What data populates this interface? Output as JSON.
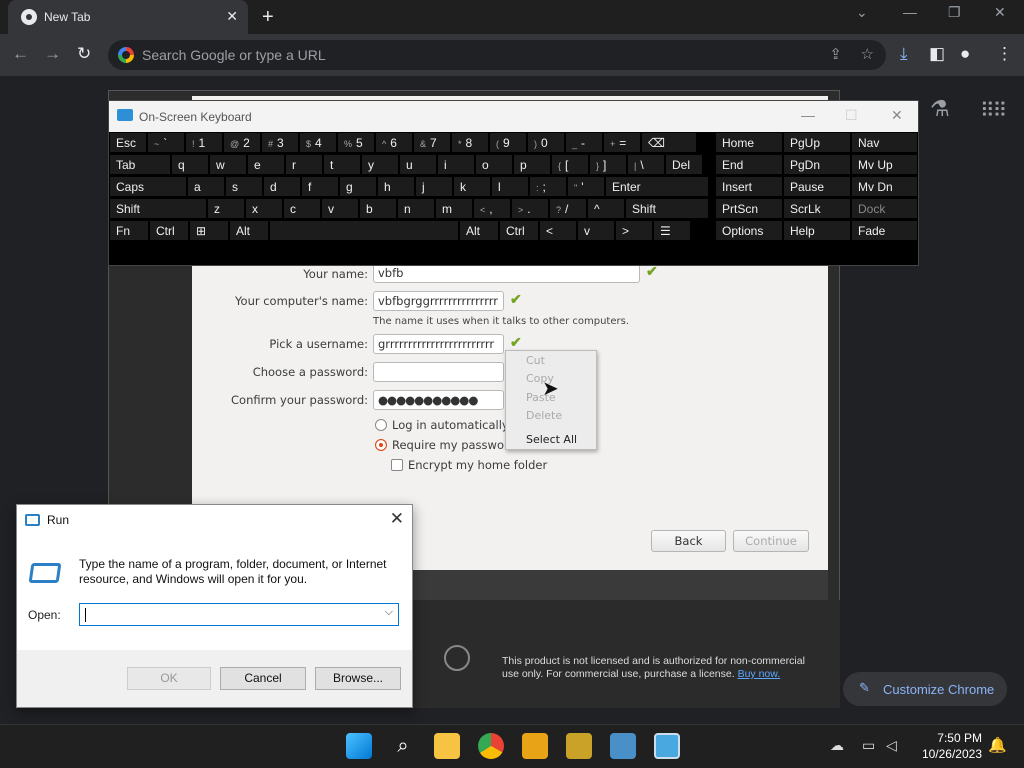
{
  "browser": {
    "tab_title": "New Tab",
    "omnibox_placeholder": "Search Google or type a URL"
  },
  "osk": {
    "title": "On-Screen Keyboard",
    "rows": [
      [
        {
          "l": "Esc"
        },
        {
          "s": "~",
          "l": "`"
        },
        {
          "s": "!",
          "l": "1"
        },
        {
          "s": "@",
          "l": "2"
        },
        {
          "s": "#",
          "l": "3"
        },
        {
          "s": "$",
          "l": "4"
        },
        {
          "s": "%",
          "l": "5"
        },
        {
          "s": "^",
          "l": "6"
        },
        {
          "s": "&",
          "l": "7"
        },
        {
          "s": "*",
          "l": "8"
        },
        {
          "s": "(",
          "l": "9"
        },
        {
          "s": ")",
          "l": "0"
        },
        {
          "s": "_",
          "l": "-"
        },
        {
          "s": "+",
          "l": "="
        },
        {
          "l": "⌫"
        }
      ],
      [
        {
          "l": "Tab"
        },
        {
          "l": "q"
        },
        {
          "l": "w"
        },
        {
          "l": "e"
        },
        {
          "l": "r"
        },
        {
          "l": "t"
        },
        {
          "l": "y"
        },
        {
          "l": "u"
        },
        {
          "l": "i"
        },
        {
          "l": "o"
        },
        {
          "l": "p"
        },
        {
          "s": "{",
          "l": "["
        },
        {
          "s": "}",
          "l": "]"
        },
        {
          "s": "|",
          "l": "\\"
        },
        {
          "l": "Del"
        }
      ],
      [
        {
          "l": "Caps"
        },
        {
          "l": "a"
        },
        {
          "l": "s"
        },
        {
          "l": "d"
        },
        {
          "l": "f"
        },
        {
          "l": "g"
        },
        {
          "l": "h"
        },
        {
          "l": "j"
        },
        {
          "l": "k"
        },
        {
          "l": "l"
        },
        {
          "s": ":",
          "l": ";"
        },
        {
          "s": "\"",
          "l": "'"
        },
        {
          "l": "Enter"
        }
      ],
      [
        {
          "l": "Shift"
        },
        {
          "l": "z"
        },
        {
          "l": "x"
        },
        {
          "l": "c"
        },
        {
          "l": "v"
        },
        {
          "l": "b"
        },
        {
          "l": "n"
        },
        {
          "l": "m"
        },
        {
          "s": "<",
          "l": ","
        },
        {
          "s": ">",
          "l": "."
        },
        {
          "s": "?",
          "l": "/"
        },
        {
          "l": "^"
        },
        {
          "l": "Shift"
        }
      ],
      [
        {
          "l": "Fn"
        },
        {
          "l": "Ctrl"
        },
        {
          "l": "⊞"
        },
        {
          "l": "Alt"
        },
        {
          "l": ""
        },
        {
          "l": "Alt"
        },
        {
          "l": "Ctrl"
        },
        {
          "l": "<"
        },
        {
          "l": "v"
        },
        {
          "l": ">"
        },
        {
          "l": "☰"
        }
      ]
    ],
    "nav_keys": [
      [
        "Home",
        "PgUp",
        "Nav"
      ],
      [
        "End",
        "PgDn",
        "Mv Up"
      ],
      [
        "Insert",
        "Pause",
        "Mv Dn"
      ],
      [
        "PrtScn",
        "ScrLk",
        "Dock"
      ],
      [
        "Options",
        "Help",
        "Fade"
      ]
    ]
  },
  "installer": {
    "your_name_label": "Your name:",
    "your_name_value": "vbfb",
    "computer_name_label": "Your computer's name:",
    "computer_name_value": "vbfbgrggrrrrrrrrrrrrrrr",
    "computer_name_hint": "The name it uses when it talks to other computers.",
    "username_label": "Pick a username:",
    "username_value": "grrrrrrrrrrrrrrrrrrrrrrrr",
    "password_label": "Choose a password:",
    "password_value": "",
    "confirm_label": "Confirm your password:",
    "confirm_value": "●●●●●●●●●●●",
    "login_auto": "Log in automatically",
    "require_password": "Require my password",
    "encrypt_home": "Encrypt my home folder",
    "back": "Back",
    "continue": "Continue"
  },
  "context_menu": {
    "items": [
      "Cut",
      "Copy",
      "Paste",
      "Delete",
      "Select All"
    ]
  },
  "license": {
    "text": "This product is not licensed and is authorized for non-commercial use only. For commercial use, purchase a license.",
    "link": "Buy now."
  },
  "run": {
    "title": "Run",
    "description": "Type the name of a program, folder, document, or Internet resource, and Windows will open it for you.",
    "open_label": "Open:",
    "ok": "OK",
    "cancel": "Cancel",
    "browse": "Browse..."
  },
  "customize_chrome": "Customize Chrome",
  "taskbar": {
    "time": "7:50 PM",
    "date": "10/26/2023"
  }
}
